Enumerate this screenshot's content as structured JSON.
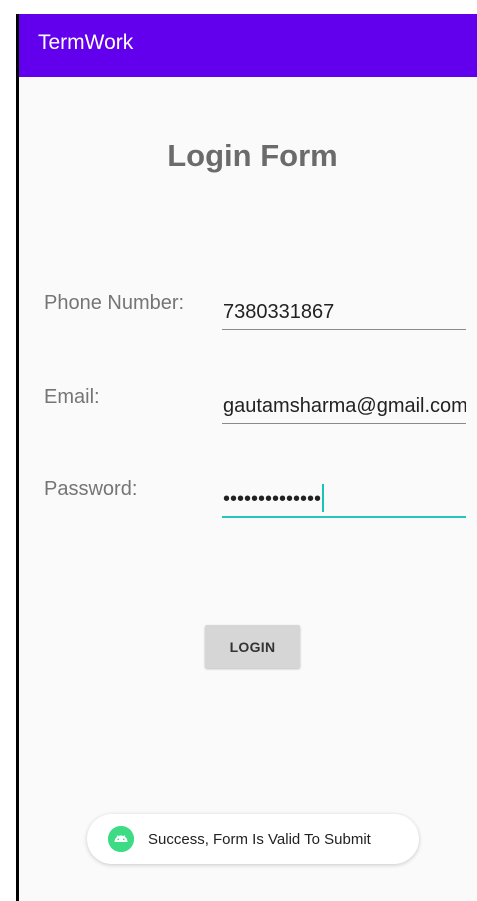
{
  "app": {
    "title": "TermWork",
    "appbar_color": "#6200ee"
  },
  "form": {
    "heading": "Login Form",
    "phone": {
      "label": "Phone Number:",
      "value": "7380331867"
    },
    "email": {
      "label": "Email:",
      "value": "gautamsharma@gmail.com"
    },
    "password": {
      "label": "Password:",
      "masked_value": "••••••••••••••",
      "focused": true,
      "focus_color": "#26c6b8"
    },
    "login_button_label": "LOGIN"
  },
  "toast": {
    "icon": "android-icon",
    "icon_color": "#3ddc84",
    "message": "Success, Form Is Valid To Submit"
  }
}
